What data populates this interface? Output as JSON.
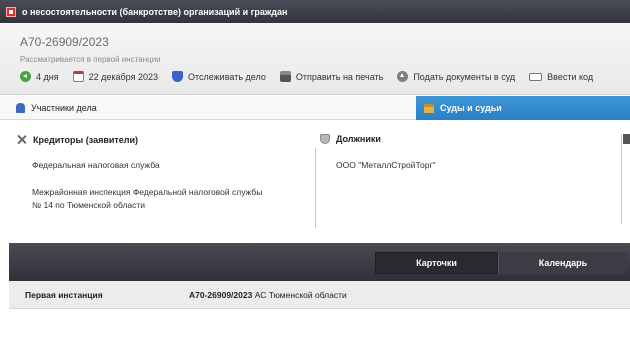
{
  "window": {
    "title": "о несостоятельности (банкротстве) организаций и граждан"
  },
  "case": {
    "number": "А70-26909/2023",
    "status": "Рассматривается в первой инстанции"
  },
  "actions": [
    {
      "label": "4 дня",
      "icon": "back-arrow-icon"
    },
    {
      "label": "22 декабря 2023",
      "icon": "calendar-icon"
    },
    {
      "label": "Отслеживать дело",
      "icon": "shield-icon"
    },
    {
      "label": "Отправить на печать",
      "icon": "printer-icon"
    },
    {
      "label": "Подать документы в суд",
      "icon": "upload-icon"
    },
    {
      "label": "Ввести код",
      "icon": "keyboard-icon"
    }
  ],
  "tabs": {
    "participants": "Участники дела",
    "courts": "Суды и судьи"
  },
  "creditors": {
    "heading": "Кредиторы (заявители)",
    "items": [
      "Федеральная налоговая служба",
      "Межрайонная инспекция Федеральной налоговой службы",
      "№ 14 по Тюменской области"
    ]
  },
  "debtors": {
    "heading": "Должники",
    "items": [
      "ООО \"МеталлСтройТорг\""
    ]
  },
  "bottom_tabs": {
    "cards": "Карточки",
    "calendar": "Календарь"
  },
  "instance": {
    "label": "Первая инстанция",
    "case_no": "А70-26909/2023",
    "court": "АС Тюменской области"
  },
  "colors": {
    "accent": "#2f8acb",
    "topbar": "#3b3d45"
  }
}
